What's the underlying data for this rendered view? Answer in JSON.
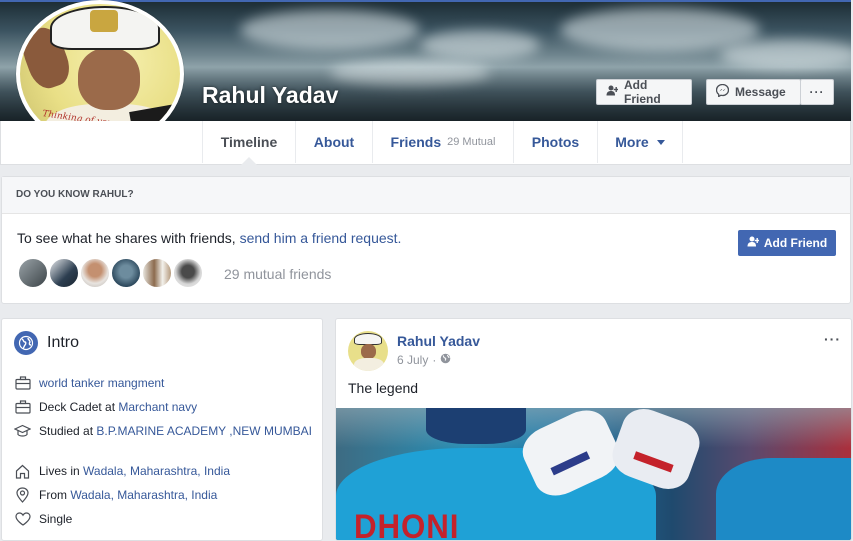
{
  "profile": {
    "name": "Rahul Yadav",
    "picture_text": "Thinking of you"
  },
  "cover_actions": {
    "add_friend": "Add Friend",
    "message": "Message",
    "more": "···"
  },
  "nav": {
    "timeline": "Timeline",
    "about": "About",
    "friends": "Friends",
    "friends_mutual": "29 Mutual",
    "photos": "Photos",
    "more": "More"
  },
  "know": {
    "header": "DO YOU KNOW RAHUL?",
    "text_prefix": "To see what he shares with friends,",
    "link": "send him a friend request.",
    "button": "Add Friend",
    "mutual_count": "29 mutual friends"
  },
  "intro": {
    "title": "Intro",
    "rows": [
      {
        "icon": "briefcase-icon",
        "prefix": "",
        "link": "world tanker mangment",
        "suffix": ""
      },
      {
        "icon": "briefcase-icon",
        "prefix": "Deck Cadet at ",
        "link": "Marchant navy",
        "suffix": ""
      },
      {
        "icon": "graduation-cap-icon",
        "prefix": "Studied at ",
        "link": "B.P.MARINE ACADEMY ,NEW MUMBAI",
        "suffix": ""
      },
      {
        "icon": "home-icon",
        "prefix": "Lives in ",
        "link": "Wadala, Maharashtra, India",
        "suffix": ""
      },
      {
        "icon": "location-pin-icon",
        "prefix": "From ",
        "link": "Wadala, Maharashtra, India",
        "suffix": ""
      },
      {
        "icon": "heart-icon",
        "prefix": "Single",
        "link": "",
        "suffix": ""
      }
    ]
  },
  "post": {
    "author": "Rahul Yadav",
    "date": "6 July",
    "privacy_icon": "globe-icon",
    "options": "···",
    "text": "The legend",
    "image_text": "DHONI"
  },
  "colors": {
    "brand_blue": "#4267b2",
    "link_blue": "#365899",
    "page_bg": "#e9ebee"
  }
}
